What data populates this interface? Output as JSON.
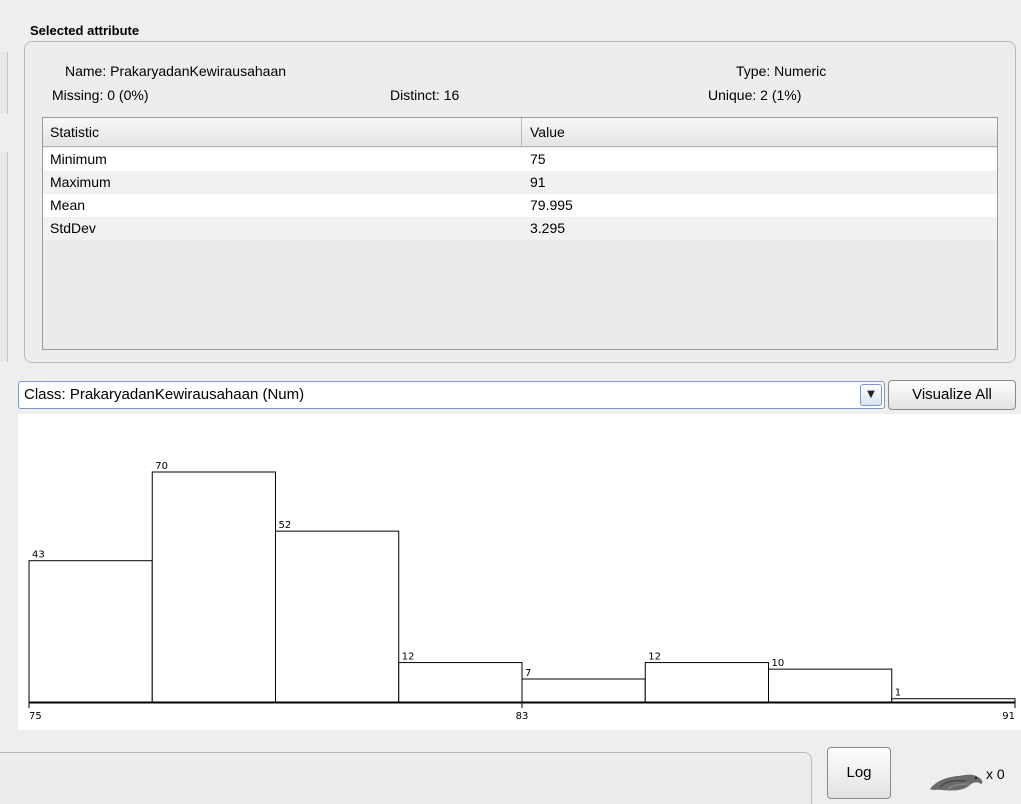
{
  "selected_attribute": {
    "section_title": "Selected attribute",
    "name_label": "Name:",
    "name_value": "PrakaryadanKewirausahaan",
    "missing_label": "Missing:",
    "missing_value": "0 (0%)",
    "distinct_label": "Distinct:",
    "distinct_value": "16",
    "type_label": "Type:",
    "type_value": "Numeric",
    "unique_label": "Unique:",
    "unique_value": "2 (1%)"
  },
  "stats_table": {
    "headers": [
      "Statistic",
      "Value"
    ],
    "rows": [
      {
        "statistic": "Minimum",
        "value": "75"
      },
      {
        "statistic": "Maximum",
        "value": "91"
      },
      {
        "statistic": "Mean",
        "value": "79.995"
      },
      {
        "statistic": "StdDev",
        "value": "3.295"
      }
    ]
  },
  "class_selector": {
    "selected": "Class: PrakaryadanKewirausahaan (Num)"
  },
  "buttons": {
    "visualize_all": "Visualize All",
    "log": "Log"
  },
  "status": {
    "weka_task_count": "x 0"
  },
  "chart_data": {
    "type": "bar",
    "values": [
      43,
      70,
      52,
      12,
      7,
      12,
      10,
      1
    ],
    "xmin": 75,
    "xmax": 91,
    "tick_labels": [
      "75",
      "83",
      "91"
    ],
    "value_labels": [
      "43",
      "70",
      "52",
      "12",
      "7",
      "12",
      "10",
      "1"
    ]
  },
  "colors": {
    "background": "#eeeeee",
    "bar_fill": "#ffffff",
    "bar_stroke": "#000000",
    "combo_border": "#7c9ac2"
  }
}
